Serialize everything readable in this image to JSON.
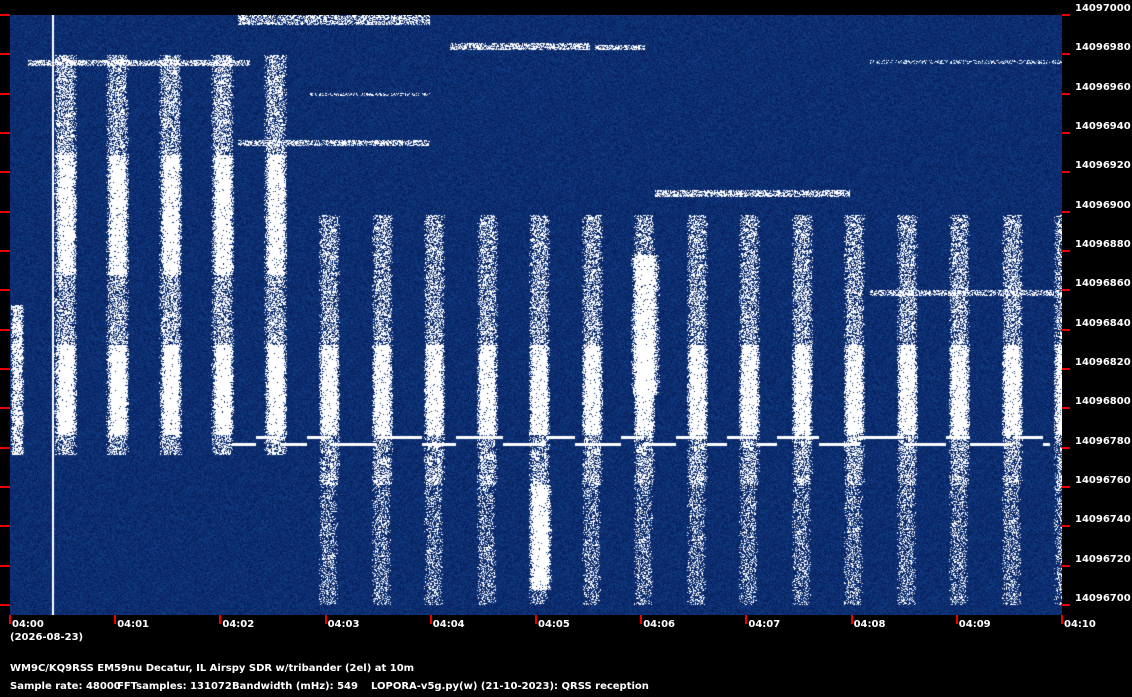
{
  "frequency_axis": {
    "ticks": [
      "14097000",
      "14096980",
      "14096960",
      "14096940",
      "14096920",
      "14096900",
      "14096880",
      "14096860",
      "14096840",
      "14096820",
      "14096800",
      "14096780",
      "14096760",
      "14096740",
      "14096720",
      "14096700"
    ]
  },
  "time_axis": {
    "ticks": [
      "04:00",
      "04:01",
      "04:02",
      "04:03",
      "04:04",
      "04:05",
      "04:06",
      "04:07",
      "04:08",
      "04:09",
      "04:10"
    ],
    "date": "(2026-08-23)"
  },
  "footer": {
    "station": "WM9C/KQ9RSS EM59nu Decatur, IL  Airspy SDR w/tribander (2el) at 10m",
    "sample_rate": "Sample rate: 48000",
    "fft_samples": "FFTsamples: 131072",
    "bandwidth": "Bandwidth (mHz): 549",
    "software": "LOPORA-v5g.py(w) (21-10-2023): QRSS reception"
  },
  "colors": {
    "background": "#0a2a66",
    "signal": "#ffffff",
    "tick": "#ee0000"
  }
}
